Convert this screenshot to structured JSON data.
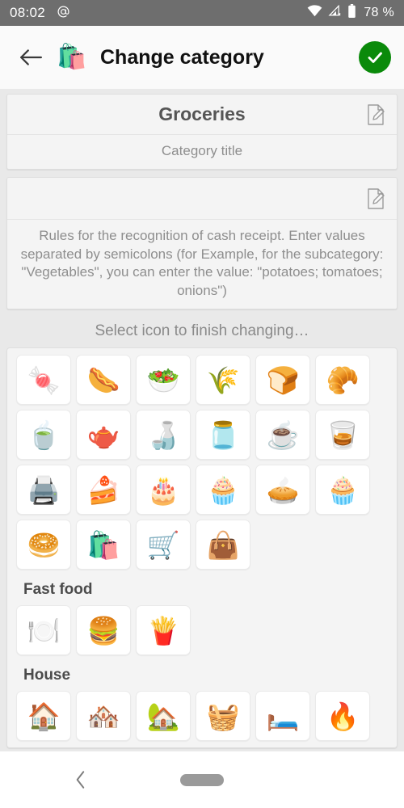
{
  "status_bar": {
    "time": "08:02",
    "at_icon": "at-icon",
    "wifi_icon": "wifi-icon",
    "cellular_icon": "cellular-no-signal-icon",
    "battery_icon": "battery-icon",
    "battery_text": "78 %"
  },
  "app_bar": {
    "back_icon": "back-arrow-icon",
    "category_emoji": "🛍️",
    "title": "Change category",
    "confirm_icon": "check-icon",
    "confirm_color": "#0a8a0a"
  },
  "form": {
    "title_field": {
      "value": "Groceries",
      "hint": "Category title",
      "edit_icon": "edit-icon"
    },
    "rules_field": {
      "value": "",
      "hint": "Rules for the recognition of cash receipt. Enter values separated by semicolons\n(for Example, for the subcategory: \"Vegetables\", you can enter the value: \"potatoes; tomatoes; onions\")",
      "edit_icon": "edit-icon"
    }
  },
  "icon_picker": {
    "hint": "Select icon to finish changing…",
    "groups": [
      {
        "title": "",
        "icons": [
          {
            "name": "candy-icon",
            "glyph": "🍬"
          },
          {
            "name": "sausage-icon",
            "glyph": "🌭"
          },
          {
            "name": "salad-bowl-icon",
            "glyph": "🥗"
          },
          {
            "name": "wheat-bread-icon",
            "glyph": "🌾"
          },
          {
            "name": "sliced-bread-icon",
            "glyph": "🍞"
          },
          {
            "name": "buns-icon",
            "glyph": "🥐"
          },
          {
            "name": "tea-cup-icon",
            "glyph": "🍵"
          },
          {
            "name": "tea-glass-icon",
            "glyph": "🫖"
          },
          {
            "name": "green-tea-cup-icon",
            "glyph": "🍶"
          },
          {
            "name": "moka-pot-icon",
            "glyph": "🫙"
          },
          {
            "name": "coffee-saucer-icon",
            "glyph": "☕"
          },
          {
            "name": "espresso-cup-icon",
            "glyph": "🥃"
          },
          {
            "name": "coffee-machine-icon",
            "glyph": "🖨️"
          },
          {
            "name": "cake-slice-icon",
            "glyph": "🍰"
          },
          {
            "name": "tiered-cake-icon",
            "glyph": "🎂"
          },
          {
            "name": "birthday-cake-icon",
            "glyph": "🧁"
          },
          {
            "name": "fruit-tart-icon",
            "glyph": "🥧"
          },
          {
            "name": "cupcake-icon",
            "glyph": "🧁"
          },
          {
            "name": "bagel-icon",
            "glyph": "🥯"
          },
          {
            "name": "black-shopping-bag-icon",
            "glyph": "🛍️"
          },
          {
            "name": "teal-shopping-bag-icon",
            "glyph": "🛒"
          },
          {
            "name": "yellow-shopping-bag-icon",
            "glyph": "👜"
          }
        ]
      },
      {
        "title": "Fast food",
        "icons": [
          {
            "name": "plate-cutlery-icon",
            "glyph": "🍽️"
          },
          {
            "name": "burger-drink-icon",
            "glyph": "🍔"
          },
          {
            "name": "fries-icon",
            "glyph": "🍟"
          }
        ]
      },
      {
        "title": "House",
        "icons": [
          {
            "name": "house-icon",
            "glyph": "🏠"
          },
          {
            "name": "snowy-house-icon",
            "glyph": "🏘️"
          },
          {
            "name": "water-tap-house-icon",
            "glyph": "🏡"
          },
          {
            "name": "food-basket-icon",
            "glyph": "🧺"
          },
          {
            "name": "bed-icon",
            "glyph": "🛏️"
          },
          {
            "name": "stove-fire-icon",
            "glyph": "🔥"
          }
        ]
      }
    ]
  },
  "nav_bar": {
    "back_icon": "nav-back-icon",
    "home_pill_icon": "home-pill-icon"
  }
}
